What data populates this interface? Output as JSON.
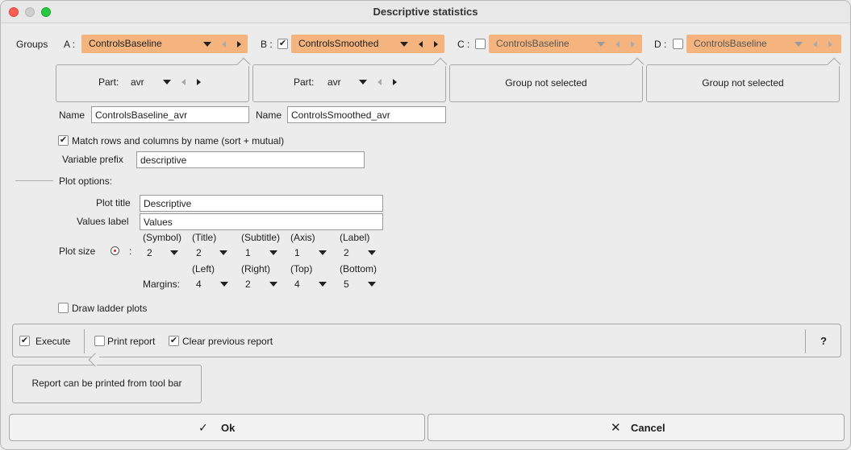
{
  "window": {
    "title": "Descriptive statistics"
  },
  "groups": {
    "label": "Groups",
    "a": {
      "letter": "A :",
      "name": "ControlsBaseline",
      "part_label": "Part:",
      "part_value": "avr",
      "name_label": "Name",
      "name_value": "ControlsBaseline_avr"
    },
    "b": {
      "letter": "B :",
      "checked": true,
      "name": "ControlsSmoothed",
      "part_label": "Part:",
      "part_value": "avr",
      "name_label": "Name",
      "name_value": "ControlsSmoothed_avr"
    },
    "c": {
      "letter": "C :",
      "checked": false,
      "name": "ControlsBaseline",
      "status": "Group not selected"
    },
    "d": {
      "letter": "D :",
      "checked": false,
      "name": "ControlsBaseline",
      "status": "Group not selected"
    }
  },
  "options": {
    "match_label": "Match rows and columns by name (sort + mutual)",
    "match_checked": true,
    "prefix_label": "Variable prefix",
    "prefix_value": "descriptive"
  },
  "plot": {
    "section_label": "Plot options:",
    "title_label": "Plot title",
    "title_value": "Descriptive",
    "values_label": "Values label",
    "values_value": "Values",
    "size_label": "Plot size",
    "size_colon": ":",
    "size_headers": [
      "(Symbol)",
      "(Title)",
      "(Subtitle)",
      "(Axis)",
      "(Label)"
    ],
    "size_values": [
      "2",
      "2",
      "1",
      "1",
      "2"
    ],
    "margin_headers": [
      "(Left)",
      "(Right)",
      "(Top)",
      "(Bottom)"
    ],
    "margins_label": "Margins:",
    "margin_values": [
      "4",
      "2",
      "4",
      "5"
    ],
    "ladder_label": "Draw ladder plots",
    "ladder_checked": false
  },
  "exec": {
    "execute_label": "Execute",
    "execute_checked": true,
    "print_label": "Print report",
    "print_checked": false,
    "clear_label": "Clear previous report",
    "clear_checked": true,
    "help_label": "?",
    "hint": "Report can be printed from tool bar"
  },
  "buttons": {
    "ok": "Ok",
    "cancel": "Cancel"
  },
  "check_glyph": "✔"
}
